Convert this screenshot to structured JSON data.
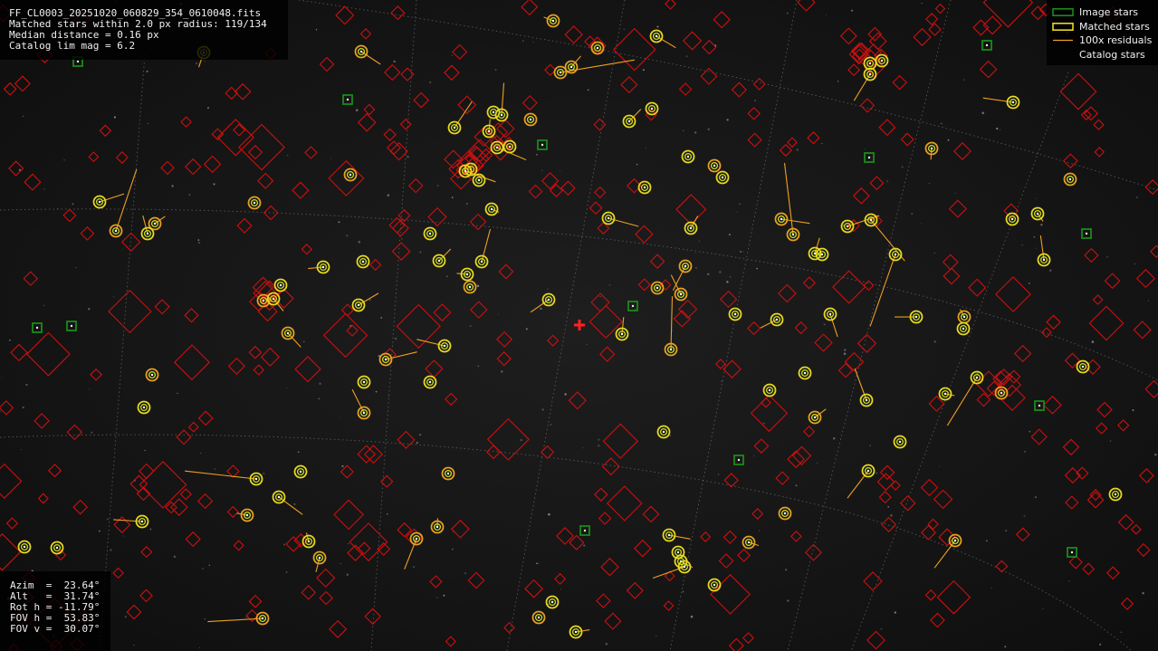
{
  "window": {
    "title": "FF_CL0003_20251020_060829_354_0610048.fits"
  },
  "info_top": {
    "filename": "FF_CL0003_20251020_060829_354_0610048.fits",
    "matched": "Matched stars within 2.0 px radius: 119/134",
    "median": "Median distance = 0.16 px",
    "catalog_lim": "Catalog lim mag = 6.2"
  },
  "info_bottom": {
    "azim": "Azim  =  23.64°",
    "alt": "Alt   =  31.74°",
    "rot": "Rot h = -11.79°",
    "fov_h": "FOV h =  53.83°",
    "fov_v": "FOV v =  30.07°"
  },
  "legend": {
    "image_stars": "Image stars",
    "matched_stars": "Matched stars",
    "residuals": "100x residuals",
    "catalog_stars": "Catalog stars"
  },
  "colors": {
    "image_star": "#1a8a1a",
    "matched_outer": "#e8d820",
    "matched_inner": "#c8e020",
    "residual": "#f0a020",
    "catalog": "#cc1010",
    "center_cross": "#ff2020",
    "grid": "#8c8c8c"
  },
  "icons": {
    "center_marker": "red-cross-icon"
  }
}
